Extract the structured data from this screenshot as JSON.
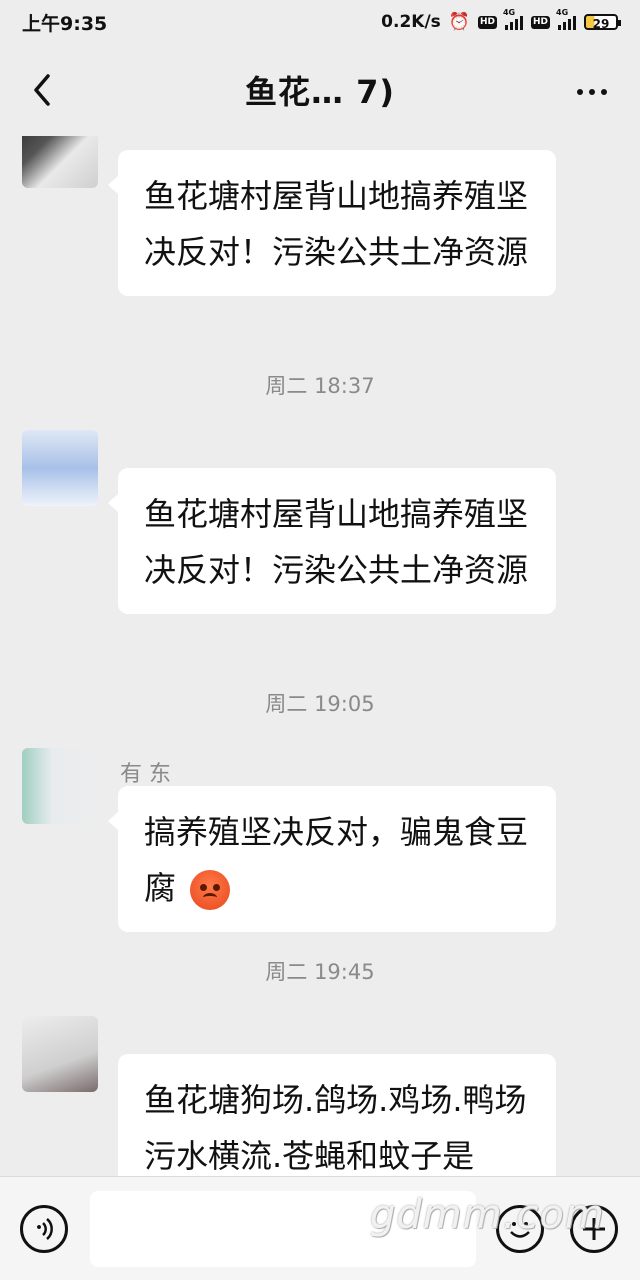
{
  "status_bar": {
    "time": "上午9:35",
    "net_speed": "0.2K/s",
    "badge_hd_1": "HD",
    "badge_4g_1": "4G",
    "badge_hd_2": "HD",
    "badge_4g_2": "4G",
    "battery": "29"
  },
  "header": {
    "title": "鱼花… 7)"
  },
  "messages": [
    {
      "sender": "",
      "text": "鱼花塘村屋背山地搞养殖坚决反对！污染公共土净资源"
    },
    {
      "timestamp": "周二 18:37",
      "sender": "",
      "text": "鱼花塘村屋背山地搞养殖坚决反对！污染公共土净资源"
    },
    {
      "timestamp": "周二 19:05",
      "sender": "有         东",
      "text": "搞养殖坚决反对，骗鬼食豆腐",
      "emoji": "angry-face"
    },
    {
      "timestamp": "周二 19:45",
      "sender": "",
      "text": "鱼花塘狗场.鸽场.鸡场.鸭场污水横流.苍蝇和蚊子是"
    }
  ],
  "input_bar": {
    "voice_icon": "voice-icon",
    "emoji_icon": "emoji-icon",
    "plus_icon": "plus-icon"
  },
  "watermark": "gdmm.com"
}
